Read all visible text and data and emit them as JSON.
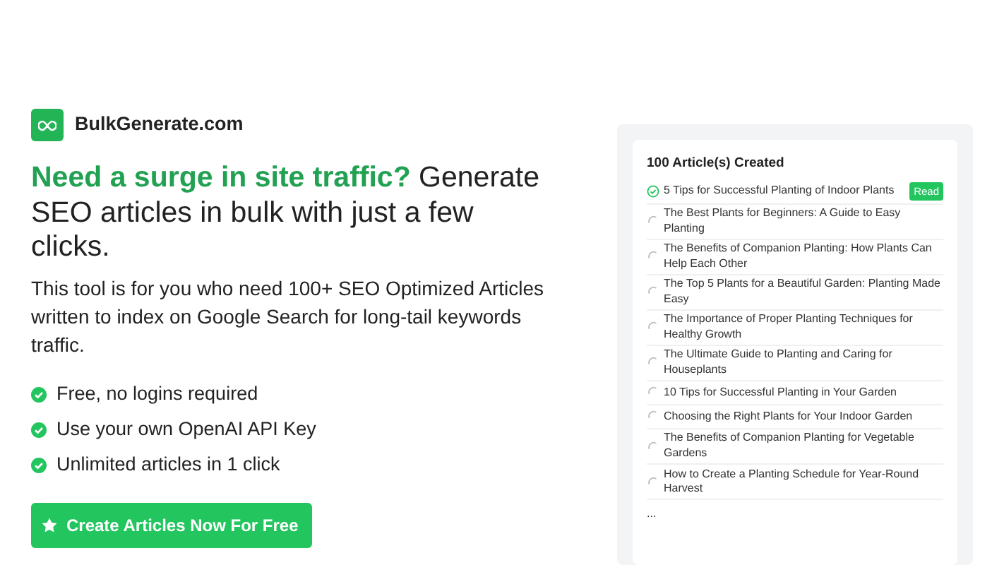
{
  "brand": {
    "name": "BulkGenerate.com"
  },
  "headline": {
    "highlight": "Need a surge in site traffic?",
    "rest": "Generate SEO articles in bulk with just a few clicks."
  },
  "description": "This tool is for you who need 100+ SEO Optimized Articles written to index on Google Search for long-tail keywords traffic.",
  "features": [
    "Free, no logins required",
    "Use your own OpenAI API Key",
    "Unlimited articles in 1 click"
  ],
  "cta": {
    "label": "Create Articles Now For Free"
  },
  "panel": {
    "title": "100 Article(s) Created",
    "articles": [
      {
        "title": "5 Tips for Successful Planting of Indoor Plants",
        "done": true,
        "badge": "Read"
      },
      {
        "title": "The Best Plants for Beginners: A Guide to Easy Planting",
        "done": false
      },
      {
        "title": "The Benefits of Companion Planting: How Plants Can Help Each Other",
        "done": false
      },
      {
        "title": "The Top 5 Plants for a Beautiful Garden: Planting Made Easy",
        "done": false
      },
      {
        "title": "The Importance of Proper Planting Techniques for Healthy Growth",
        "done": false
      },
      {
        "title": "The Ultimate Guide to Planting and Caring for Houseplants",
        "done": false
      },
      {
        "title": "10 Tips for Successful Planting in Your Garden",
        "done": false
      },
      {
        "title": "Choosing the Right Plants for Your Indoor Garden",
        "done": false
      },
      {
        "title": "The Benefits of Companion Planting for Vegetable Gardens",
        "done": false
      },
      {
        "title": "How to Create a Planting Schedule for Year-Round Harvest",
        "done": false
      }
    ],
    "more": "..."
  }
}
